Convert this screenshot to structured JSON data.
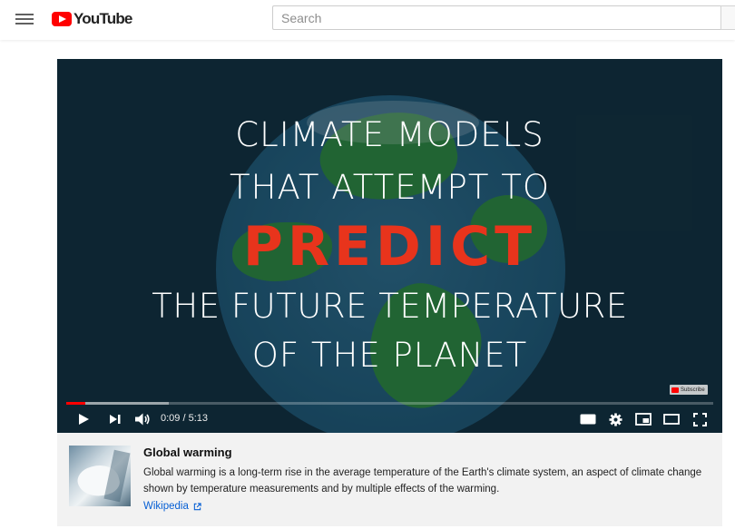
{
  "header": {
    "logo_text": "YouTube",
    "search_placeholder": "Search"
  },
  "video": {
    "overlay_lines": [
      "CLIMATE MODELS",
      "THAT ATTEMPT TO",
      "PREDICT",
      "THE FUTURE TEMPERATURE",
      "OF THE PLANET"
    ],
    "accent_color": "#e8341c",
    "watermark_label": "Subscribe",
    "time_display": "0:09 / 5:13",
    "progress_played_fraction": 0.029,
    "progress_loaded_fraction": 0.159
  },
  "controls": {
    "icons": [
      "play-icon",
      "next-icon",
      "volume-icon",
      "captions-icon",
      "settings-icon",
      "miniplayer-icon",
      "theater-mode-icon",
      "fullscreen-icon"
    ],
    "captions_label": "CC"
  },
  "info_panel": {
    "title": "Global warming",
    "description": "Global warming is a long-term rise in the average temperature of the Earth's climate system, an aspect of climate change shown by temperature measurements and by multiple effects of the warming.",
    "source_link": "Wikipedia"
  },
  "colors": {
    "brand_red": "#ff0000",
    "link_blue": "#065fd4"
  }
}
